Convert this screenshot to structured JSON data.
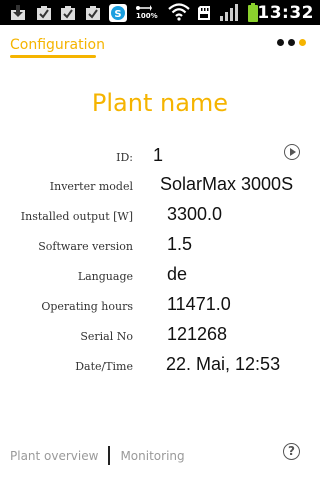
{
  "status_bar": {
    "time": "13:32",
    "battery_percent_label": "100%",
    "icons": [
      "download-icon",
      "checkbox-icon",
      "checkbox-icon",
      "checkbox-icon",
      "skype-icon",
      "usb-icon",
      "wifi-icon",
      "sd-card-icon",
      "signal-icon",
      "battery-icon"
    ]
  },
  "header": {
    "tab_label": "Configuration",
    "page_count": 3,
    "active_page": 3
  },
  "plant": {
    "name": "Plant name"
  },
  "details": [
    {
      "label": "ID:",
      "value": "1"
    },
    {
      "label": "Inverter model",
      "value": "SolarMax 3000S"
    },
    {
      "label": "Installed output [W]",
      "value": "3300.0"
    },
    {
      "label": "Software version",
      "value": "1.5"
    },
    {
      "label": "Language",
      "value": "de"
    },
    {
      "label": "Operating hours",
      "value": "11471.0"
    },
    {
      "label": "Serial No",
      "value": "121268"
    },
    {
      "label": "Date/Time",
      "value": "22. Mai, 12:53"
    }
  ],
  "bottom_nav": {
    "left_label": "Plant overview",
    "right_label": "Monitoring",
    "help_glyph": "?"
  },
  "colors": {
    "accent": "#f5b400",
    "status_bar_bg": "#000000",
    "battery_green": "#8bd12d",
    "nav_text": "#9a9a9a"
  }
}
